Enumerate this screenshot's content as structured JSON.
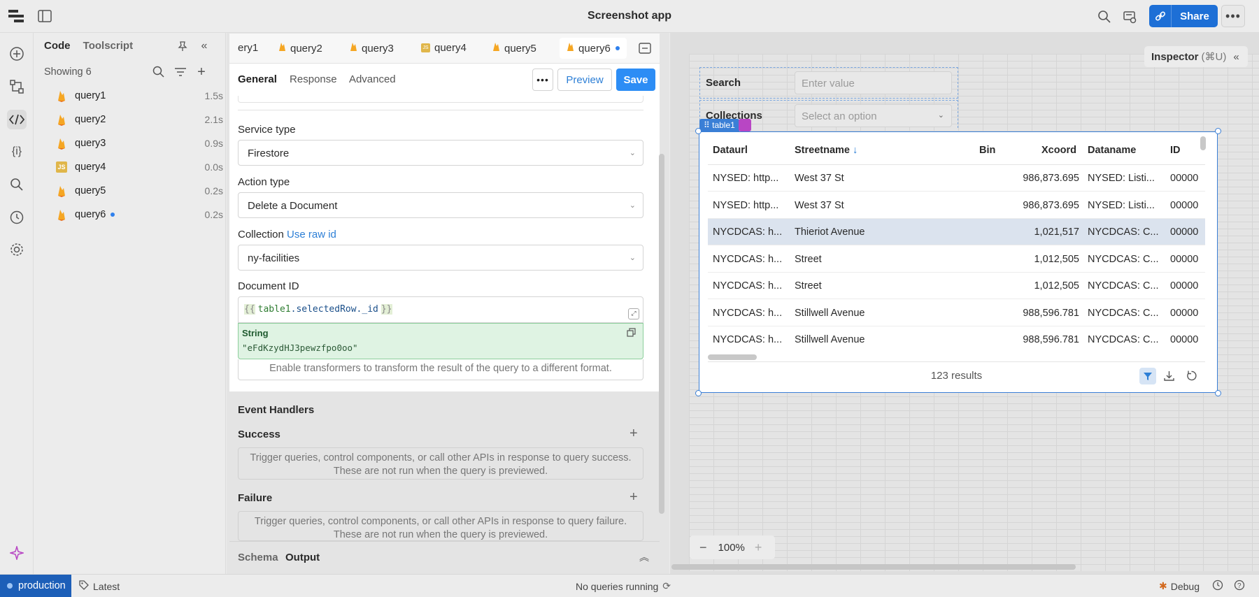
{
  "app": {
    "title": "Screenshot app",
    "share_label": "Share"
  },
  "left_panel": {
    "tab_code": "Code",
    "tab_toolscript": "Toolscript",
    "showing": "Showing 6",
    "queries": [
      {
        "name": "query1",
        "time": "1.5s",
        "icon": "firebase-icon"
      },
      {
        "name": "query2",
        "time": "2.1s",
        "icon": "firebase-icon"
      },
      {
        "name": "query3",
        "time": "0.9s",
        "icon": "firebase-icon"
      },
      {
        "name": "query4",
        "time": "0.0s",
        "icon": "js-icon"
      },
      {
        "name": "query5",
        "time": "0.2s",
        "icon": "firebase-icon"
      },
      {
        "name": "query6",
        "time": "0.2s",
        "icon": "firebase-icon"
      }
    ]
  },
  "editor": {
    "tabs": [
      "ery1",
      "query2",
      "query3",
      "query4",
      "query5",
      "query6"
    ],
    "subtabs": {
      "general": "General",
      "response": "Response",
      "advanced": "Advanced"
    },
    "preview_label": "Preview",
    "save_label": "Save",
    "service_type_label": "Service type",
    "service_type_value": "Firestore",
    "action_type_label": "Action type",
    "action_type_value": "Delete a Document",
    "collection_label": "Collection",
    "use_raw_id": "Use raw id",
    "collection_value": "ny-facilities",
    "document_id_label": "Document ID",
    "document_id_open": "{{",
    "document_id_obj": "table1",
    "document_id_prop": ".selectedRow.",
    "document_id_field": "_id",
    "document_id_close": "}}",
    "eval_type": "String",
    "eval_value": "\"eFdKzydHJ3pewzfpo0oo\"",
    "transformers_hint": "Enable transformers to transform the result of the query to a different format.",
    "event_handlers": "Event Handlers",
    "success_label": "Success",
    "success_hint_1": "Trigger queries, control components, or call other APIs in response to query success.",
    "success_hint_2": "These are not run when the query is previewed.",
    "failure_label": "Failure",
    "failure_hint_1": "Trigger queries, control components, or call other APIs in response to query failure.",
    "failure_hint_2": "These are not run when the query is previewed.",
    "schema_label": "Schema",
    "output_label": "Output"
  },
  "canvas": {
    "inspector_label": "Inspector",
    "inspector_shortcut": "(⌘U)",
    "search_label": "Search",
    "search_placeholder": "Enter value",
    "collections_label": "Collections",
    "collections_placeholder": "Select an option",
    "table_tag": "table1",
    "columns": [
      "Dataurl",
      "Streetname",
      "Bin",
      "Xcoord",
      "Dataname",
      "ID"
    ],
    "rows": [
      [
        "NYSED: http...",
        "West 37 St",
        "",
        "986,873.695",
        "NYSED: Listi...",
        "00000"
      ],
      [
        "NYSED: http...",
        "West 37 St",
        "",
        "986,873.695",
        "NYSED: Listi...",
        "00000"
      ],
      [
        "NYCDCAS: h...",
        "Thieriot Avenue",
        "",
        "1,021,517",
        "NYCDCAS: C...",
        "00000"
      ],
      [
        "NYCDCAS: h...",
        "Street",
        "",
        "1,012,505",
        "NYCDCAS: C...",
        "00000"
      ],
      [
        "NYCDCAS: h...",
        "Street",
        "",
        "1,012,505",
        "NYCDCAS: C...",
        "00000"
      ],
      [
        "NYCDCAS: h...",
        "Stillwell Avenue",
        "",
        "988,596.781",
        "NYCDCAS: C...",
        "00000"
      ],
      [
        "NYCDCAS: h...",
        "Stillwell Avenue",
        "",
        "988,596.781",
        "NYCDCAS: C...",
        "00000"
      ]
    ],
    "results": "123 results",
    "zoom": "100%"
  },
  "statusbar": {
    "env": "production",
    "version": "Latest",
    "queries_status": "No queries running",
    "debug": "Debug"
  },
  "colors": {
    "accent": "#2d8df5",
    "share": "#1d6fd6",
    "env": "#1d5fb8",
    "selection": "#3a7fd6",
    "eval_bg": "#dff3e3"
  }
}
